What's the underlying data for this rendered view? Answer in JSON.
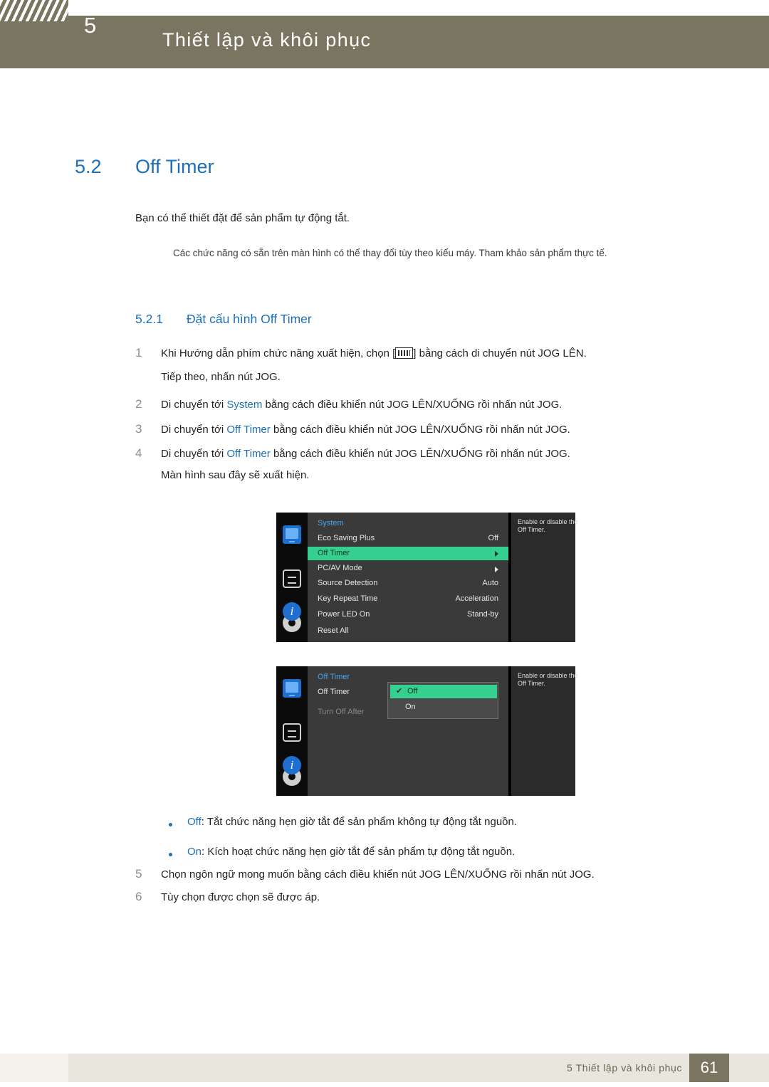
{
  "header": {
    "chapter_number": "5",
    "chapter_title": "Thiết lập và khôi phục"
  },
  "section": {
    "number": "5.2",
    "title": "Off Timer",
    "intro": "Bạn có thể thiết đặt để sản phẩm tự động tắt.",
    "note": "Các chức năng có sẵn trên màn hình có thể thay đổi tùy theo kiểu máy. Tham khảo sản phẩm thực tế."
  },
  "subsection": {
    "number": "5.2.1",
    "title": "Đặt cấu hình Off Timer"
  },
  "steps": [
    {
      "num": "1",
      "text_before": "Khi Hướng dẫn phím chức năng xuất hiện, chọn [",
      "text_after": "] bằng cách di chuyển nút JOG LÊN.",
      "line2": "Tiếp theo, nhấn nút JOG.",
      "icon": "key-guide-icon"
    },
    {
      "num": "2",
      "prefix": "Di chuyển tới ",
      "highlight": "System",
      "suffix": " bằng cách điều khiển nút JOG LÊN/XUỐNG rồi nhấn nút JOG."
    },
    {
      "num": "3",
      "prefix": "Di chuyển tới ",
      "highlight": "Off Timer",
      "suffix": " bằng cách điều khiển nút JOG LÊN/XUỐNG rồi nhấn nút JOG."
    },
    {
      "num": "4",
      "prefix": "Di chuyển tới ",
      "highlight": "Off Timer",
      "suffix": " bằng cách điều khiển nút JOG LÊN/XUỐNG rồi nhấn nút JOG.",
      "line2": "Màn hình sau đây sẽ xuất hiện."
    },
    {
      "num": "5",
      "prefix": "Chọn ngôn ngữ mong muốn bằng cách điều khiển nút JOG LÊN/XUỐNG rồi nhấn nút JOG.",
      "highlight": "",
      "suffix": ""
    },
    {
      "num": "6",
      "prefix": "Tùy chọn được chọn sẽ được áp.",
      "highlight": "",
      "suffix": ""
    }
  ],
  "osd_top": {
    "title": "System",
    "rows": [
      {
        "label": "Eco Saving Plus",
        "value": "Off",
        "selected": false,
        "arrow": false
      },
      {
        "label": "Off Timer",
        "value": "",
        "selected": true,
        "arrow": true
      },
      {
        "label": "PC/AV Mode",
        "value": "",
        "selected": false,
        "arrow": true
      },
      {
        "label": "Source Detection",
        "value": "Auto",
        "selected": false,
        "arrow": false
      },
      {
        "label": "Key Repeat Time",
        "value": "Acceleration",
        "selected": false,
        "arrow": false
      },
      {
        "label": "Power LED On",
        "value": "Stand-by",
        "selected": false,
        "arrow": false
      },
      {
        "label": "Reset All",
        "value": "",
        "selected": false,
        "arrow": false
      }
    ],
    "help": "Enable or disable the Off Timer.",
    "icons": [
      "monitor-icon",
      "arrows-icon",
      "gear-icon",
      "info-icon"
    ]
  },
  "osd_bottom": {
    "title": "Off Timer",
    "rows": [
      {
        "label": "Off Timer",
        "dim": false
      },
      {
        "label": "Turn Off After",
        "dim": true
      }
    ],
    "popup": [
      {
        "label": "Off",
        "selected": true
      },
      {
        "label": "On",
        "selected": false
      }
    ],
    "help": "Enable or disable the Off Timer.",
    "icons": [
      "monitor-icon",
      "arrows-icon",
      "gear-icon",
      "info-icon"
    ]
  },
  "bullets": [
    {
      "term": "Off",
      "text": ": Tắt chức năng hẹn giờ tắt để sản phẩm không tự động tắt nguồn."
    },
    {
      "term": "On",
      "text": ": Kích hoạt chức năng hẹn giờ tắt để sản phẩm tự động tắt nguồn."
    }
  ],
  "footer": {
    "text": "5 Thiết lập và khôi phục",
    "page": "61"
  },
  "colors": {
    "accent_blue": "#1d6fb8",
    "header_band": "#7a7560",
    "osd_green": "#35cf8f"
  }
}
